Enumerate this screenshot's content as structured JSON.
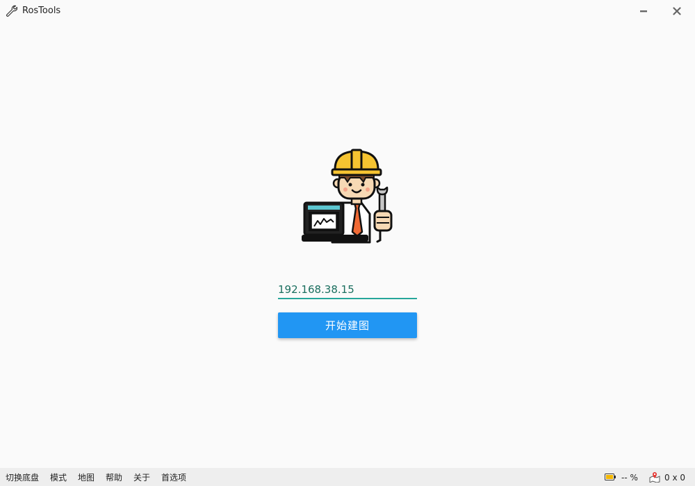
{
  "window": {
    "title": "RosTools",
    "app_icon": "wrench-icon",
    "minimize_icon": "minimize-icon",
    "close_icon": "close-icon"
  },
  "main": {
    "mascot_icon": "engineer-mascot-icon",
    "ip_value": "192.168.38.15",
    "start_button_label": "开始建图",
    "accent_color": "#26a69a",
    "button_color": "#2196f3"
  },
  "statusbar": {
    "menu": [
      "切换底盘",
      "模式",
      "地图",
      "帮助",
      "关于",
      "首选项"
    ],
    "battery_icon": "battery-icon",
    "battery_text": "-- %",
    "map_icon": "map-pin-icon",
    "map_size_text": "0 x 0"
  }
}
